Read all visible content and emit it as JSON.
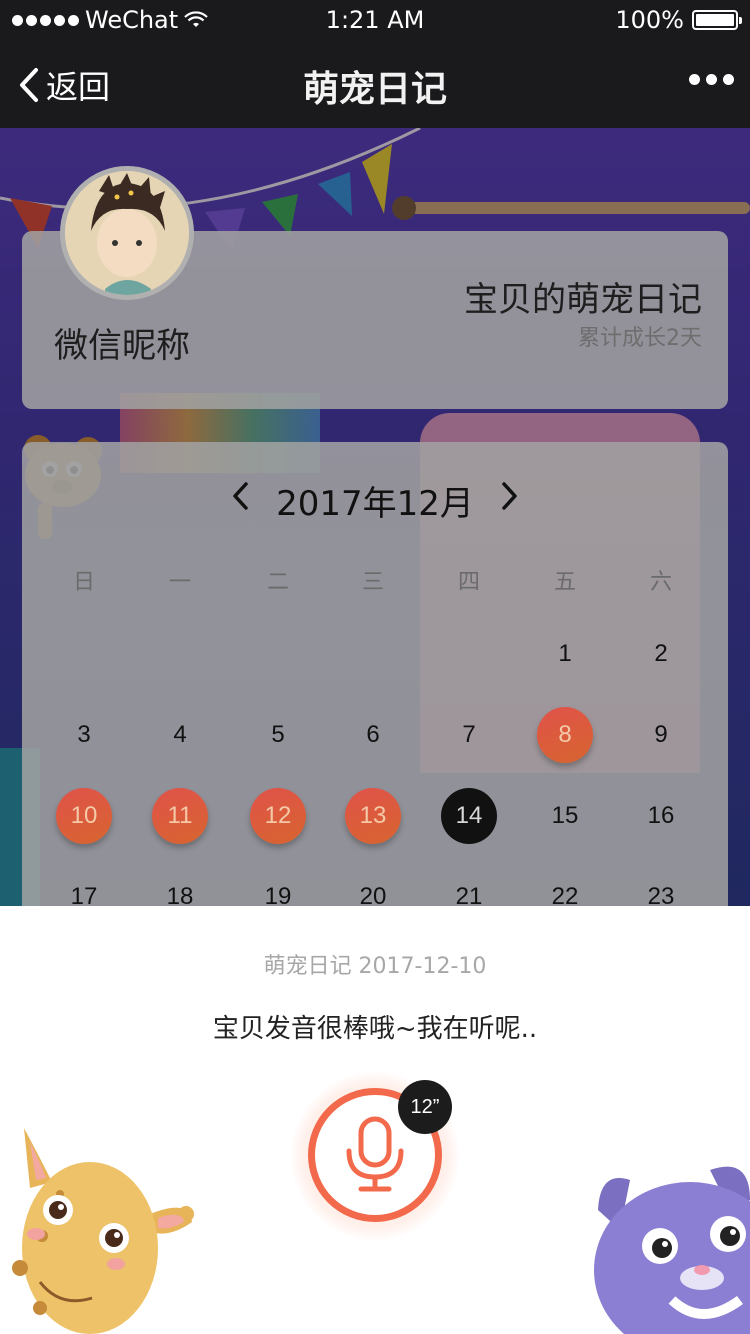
{
  "status_bar": {
    "carrier": "WeChat",
    "time": "1:21 AM",
    "battery": "100%"
  },
  "nav": {
    "back_label": "返回",
    "title": "萌宠日记"
  },
  "profile": {
    "nickname": "微信昵称",
    "diary_title": "宝贝的萌宠日记",
    "growth_text": "累计成长2天"
  },
  "calendar": {
    "month_label": "2017年12月",
    "weekdays": [
      "日",
      "一",
      "二",
      "三",
      "四",
      "五",
      "六"
    ],
    "days": [
      {
        "label": "1",
        "state": "normal"
      },
      {
        "label": "2",
        "state": "normal"
      },
      {
        "label": "3",
        "state": "normal"
      },
      {
        "label": "4",
        "state": "normal"
      },
      {
        "label": "5",
        "state": "normal"
      },
      {
        "label": "6",
        "state": "normal"
      },
      {
        "label": "7",
        "state": "normal"
      },
      {
        "label": "8",
        "state": "marked"
      },
      {
        "label": "9",
        "state": "normal"
      },
      {
        "label": "10",
        "state": "marked"
      },
      {
        "label": "11",
        "state": "marked"
      },
      {
        "label": "12",
        "state": "marked"
      },
      {
        "label": "13",
        "state": "marked"
      },
      {
        "label": "14",
        "state": "today"
      },
      {
        "label": "15",
        "state": "normal"
      },
      {
        "label": "16",
        "state": "normal"
      },
      {
        "label": "17",
        "state": "normal"
      },
      {
        "label": "18",
        "state": "normal"
      },
      {
        "label": "19",
        "state": "normal"
      },
      {
        "label": "20",
        "state": "normal"
      },
      {
        "label": "21",
        "state": "normal"
      },
      {
        "label": "22",
        "state": "normal"
      },
      {
        "label": "23",
        "state": "normal"
      }
    ]
  },
  "recorder": {
    "title": "萌宠日记 2017-12-10",
    "message": "宝贝发音很棒哦~我在听呢..",
    "duration": "12”"
  },
  "colors": {
    "accent": "#f26a4b",
    "marked_day": "#de5a3e",
    "today": "#111111"
  }
}
